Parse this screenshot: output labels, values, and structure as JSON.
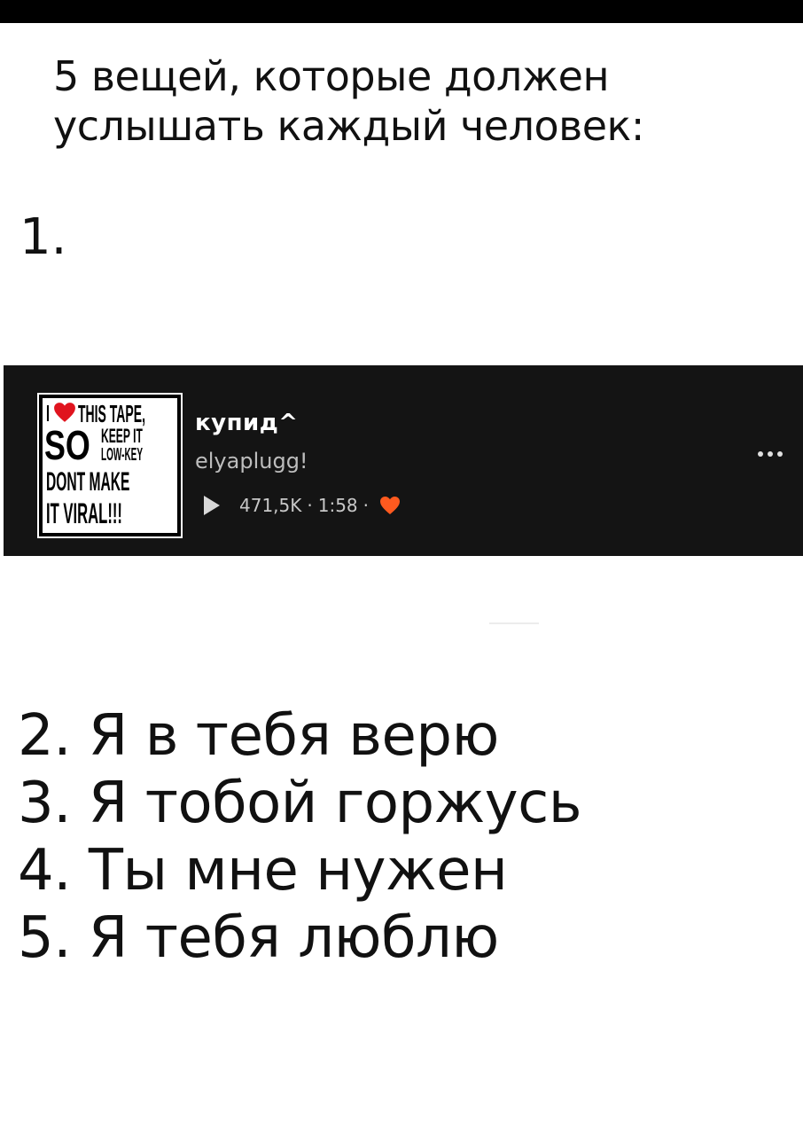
{
  "title": "5 вещей, которые должен услышать каждый человек:",
  "item_one": "1.",
  "track": {
    "cover_lines": [
      "I",
      "THIS TAPE,",
      "SO",
      "KEEP IT",
      "LOW-KEY",
      "DONT MAKE",
      "IT VIRAL!!!"
    ],
    "title": "купид^",
    "artist": "elyaplugg!",
    "plays": "471,5K",
    "duration": "1:58",
    "separator": "·",
    "like_color": "#ff5a1f",
    "more_icon": "more-dots-icon"
  },
  "list": [
    "2. Я в тебя верю",
    "3. Я тобой горжусь",
    "4. Ты мне нужен",
    "5. Я тебя люблю"
  ]
}
